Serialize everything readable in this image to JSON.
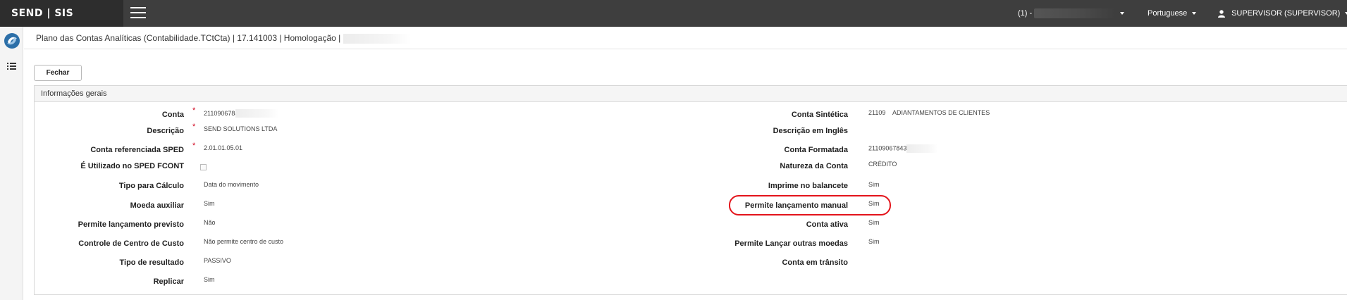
{
  "topbar": {
    "brand": "SEND | SIS",
    "company_prefix": "(1) -",
    "language": "Portuguese",
    "user": "SUPERVISOR (SUPERVISOR)"
  },
  "page": {
    "title": "Plano das Contas Analíticas (Contabilidade.TCtCta) | 17.141003 | Homologação |"
  },
  "actions": {
    "close_label": "Fechar"
  },
  "panel": {
    "title": "Informações gerais",
    "left_fields": [
      {
        "label": "Conta",
        "value": "21109067843",
        "required": true
      },
      {
        "label": "Descrição",
        "value": "SEND SOLUTIONS LTDA",
        "required": true
      },
      {
        "label": "Conta referenciada SPED",
        "value": "2.01.01.05.01",
        "required": true
      },
      {
        "label": "É Utilizado no SPED FCONT",
        "value": "",
        "checked": false
      },
      {
        "label": "Tipo para Cálculo",
        "value": "Data do movimento"
      },
      {
        "label": "Moeda auxiliar",
        "value": "Sim"
      },
      {
        "label": "Permite lançamento previsto",
        "value": "Não"
      },
      {
        "label": "Controle de Centro de Custo",
        "value": "Não permite centro de custo"
      },
      {
        "label": "Tipo de resultado",
        "value": "PASSIVO"
      },
      {
        "label": "Replicar",
        "value": "Sim"
      }
    ],
    "right_fields": [
      {
        "label": "Conta Sintética",
        "value": "21109",
        "extra": "ADIANTAMENTOS DE CLIENTES"
      },
      {
        "label": "Descrição em Inglês",
        "value": ""
      },
      {
        "label": "Conta Formatada",
        "value": "21109067843"
      },
      {
        "label": "Natureza da Conta",
        "value": "CRÉDITO"
      },
      {
        "label": "Imprime no balancete",
        "value": "Sim"
      },
      {
        "label": "Permite lançamento manual",
        "value": "Sim",
        "highlighted": true
      },
      {
        "label": "Conta ativa",
        "value": "Sim"
      },
      {
        "label": "Permite Lançar outras moedas",
        "value": "Sim"
      },
      {
        "label": "Conta em trânsito",
        "value": ""
      }
    ]
  },
  "colors": {
    "topbar": "#3e3e3e",
    "brand_bg": "#2d2d2d",
    "required": "#d0021b",
    "highlight": "#e3141b"
  }
}
